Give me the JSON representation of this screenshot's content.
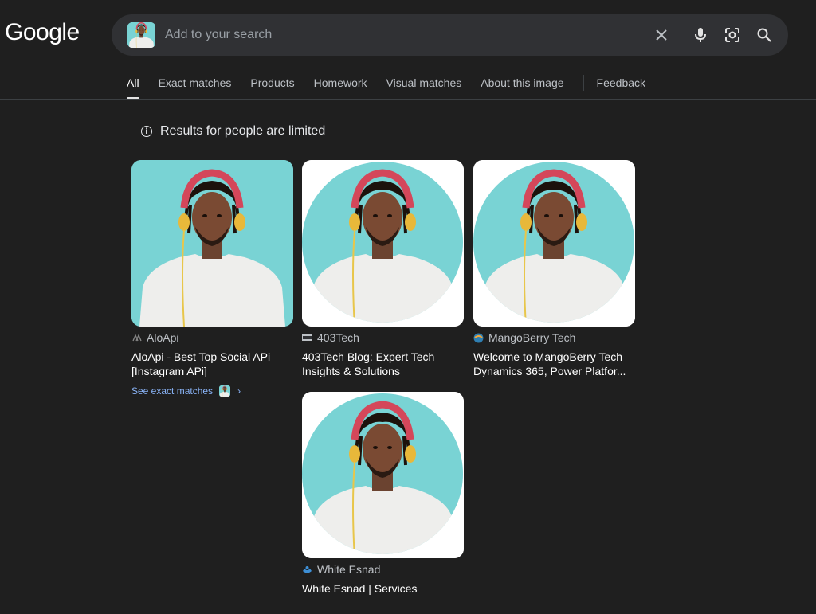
{
  "logo": "Google",
  "search": {
    "placeholder": "Add to your search",
    "clear_icon": "close-icon",
    "voice_icon": "mic-icon",
    "lens_icon": "lens-icon",
    "search_icon": "search-icon"
  },
  "tabs": [
    {
      "label": "All",
      "active": true
    },
    {
      "label": "Exact matches"
    },
    {
      "label": "Products"
    },
    {
      "label": "Homework"
    },
    {
      "label": "Visual matches"
    },
    {
      "label": "About this image"
    },
    {
      "label": "Feedback"
    }
  ],
  "notice": "Results for people are limited",
  "results": [
    {
      "source": "AloApi",
      "title": "AloApi - Best Top Social APi [Instagram APi]",
      "exact_matches": "See exact matches"
    },
    {
      "source": "403Tech",
      "title": "403Tech Blog: Expert Tech Insights & Solutions"
    },
    {
      "source": "MangoBerry Tech",
      "title": "Welcome to MangoBerry Tech – Dynamics 365, Power Platfor..."
    },
    {
      "source": "White Esnad",
      "title": "White Esnad | Services"
    }
  ],
  "colors": {
    "background": "#1f1f1f",
    "searchbar": "#303134",
    "link": "#8ab4f8",
    "image_bg": "#79d3d4"
  }
}
